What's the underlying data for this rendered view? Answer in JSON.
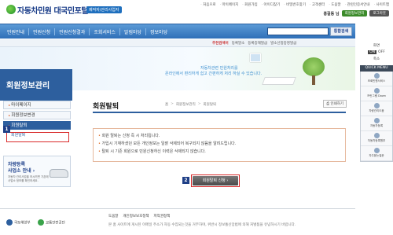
{
  "header": {
    "logo_title": "자동차민원 대국민포털",
    "logo_sub": "제작자/관리사업자",
    "top_links": [
      "처음으로",
      "마이페이지",
      "회원가입",
      "아이디찾기",
      "비밀번호찾기",
      "고객센터",
      "도움말",
      "관련인증서안내",
      "사이트맵"
    ],
    "user_name": "홍길동 님",
    "user_btn1": "회원정보관리",
    "user_btn2": "로그아웃"
  },
  "mainnav": {
    "items": [
      "민원안내",
      "민원신청",
      "민원신청결과",
      "조회서비스",
      "알림마당",
      "정보마당"
    ],
    "search_button": "통합검색"
  },
  "subnav": {
    "items": [
      "추천검색어",
      "등록말소",
      "등록증재발급",
      "발소신청중명발급"
    ]
  },
  "hero": {
    "msg1": "자동차관련 민원처리를",
    "msg2": "온라인에서 편리하게 쉽고 간편하게 처리 하실 수 있습니다."
  },
  "sidebar": {
    "title": "회원정보관리",
    "items": [
      {
        "label": "마이페이지"
      },
      {
        "label": "회원정보변경"
      },
      {
        "label": "회원탈퇴"
      }
    ],
    "sub_label": "회원탈퇴",
    "marker1": "1",
    "ad": {
      "line1": "차량등록",
      "line2": "사업소 안내 ›",
      "line3": "자동차 관리사업을 하시려면 기존에 사업소 정보를 확인하세요."
    }
  },
  "content": {
    "title": "회원탈퇴",
    "breadcrumb": [
      "홈",
      "회원정보관리",
      "회원탈퇴"
    ],
    "print_label": "인쇄하기",
    "notices": [
      "회원 탈퇴는 신청 즉 시 처리됩니다.",
      "가입시 기재하셨던 모든 개인정보는 일괄 삭제되어 복구되지 않음을 알려드립니다.",
      "탈퇴 시 기존 회원으로 민원신청하신 이력은 삭제되지 않습니다."
    ],
    "withdraw_button": "회원탈퇴 신청",
    "marker2": "2"
  },
  "quickmenu": {
    "zoom_label": "화면",
    "on": "ON",
    "off": "OFF",
    "shrink": "축소",
    "head": "QUICK MENU",
    "items": [
      "조회민원서비스",
      "프린그램 Down",
      "차량관리도움",
      "자동차등록",
      "자동차등록원부",
      "자주묻는질문"
    ]
  },
  "footer": {
    "logo1": "국토해양부",
    "logo2": "교통안전공단",
    "links": [
      "도움말",
      "개인정보보호정책",
      "저작권정책"
    ],
    "copyright": "본 홈 사이트에 게시된 이메일 주소가 자동 수집되는것을 거부하며, 위반시 정보통신망법에 의해 처벌됨을 유념하시기 바랍니다."
  },
  "colors": {
    "brand_blue": "#2d5f9e",
    "marker": "#1f3f86",
    "highlight_red": "#d92b2b",
    "accent_orange": "#e0691f"
  }
}
